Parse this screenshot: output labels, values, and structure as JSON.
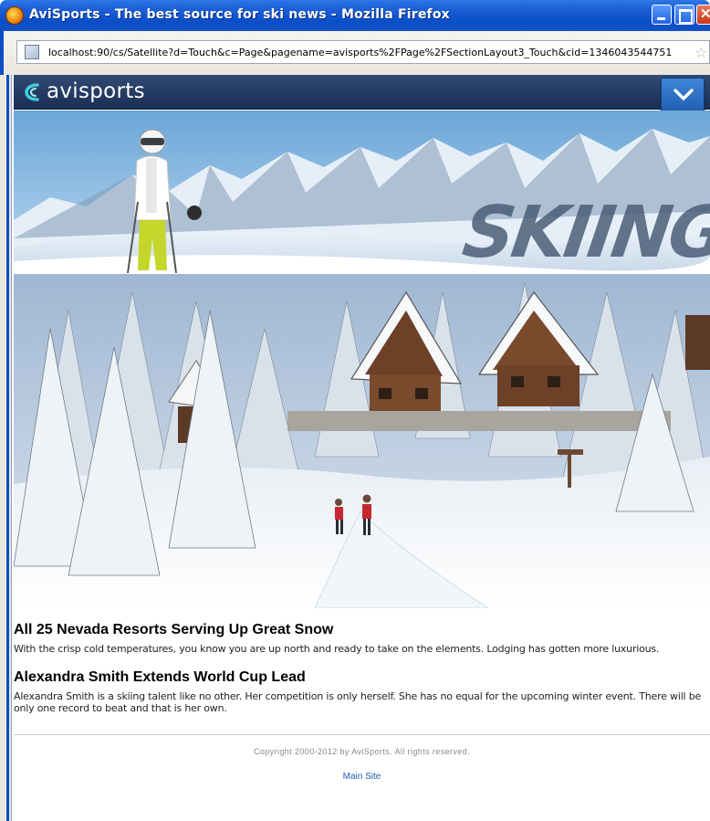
{
  "window": {
    "title": "AviSports - The best source for ski news - Mozilla Firefox",
    "icon": "firefox-icon"
  },
  "address_bar": {
    "url": "localhost:90/cs/Satellite?d=Touch&c=Page&pagename=avisports%2FPage%2FSectionLayout3_Touch&cid=1346043544751"
  },
  "header": {
    "logo_text": "avisports",
    "menu_icon": "chevron-down-icon",
    "brand_color": "#1f3a64",
    "accent_color": "#2f78cc"
  },
  "banner": {
    "section_word": "SKIING"
  },
  "articles": [
    {
      "title": "All 25 Nevada Resorts Serving Up Great Snow",
      "summary": "With the crisp cold temperatures, you know you are up north and ready to take on the elements. Lodging has gotten more luxurious."
    },
    {
      "title": "Alexandra Smith Extends World Cup Lead",
      "summary": "Alexandra Smith is a skiing talent like no other. Her competition is only herself. She has no equal for the upcoming winter event. There will be only one record to beat and that is her own."
    }
  ],
  "footer": {
    "copyright": "Copyright 2000-2012 by AviSports. All rights reserved.",
    "main_site_link": "Main Site"
  }
}
